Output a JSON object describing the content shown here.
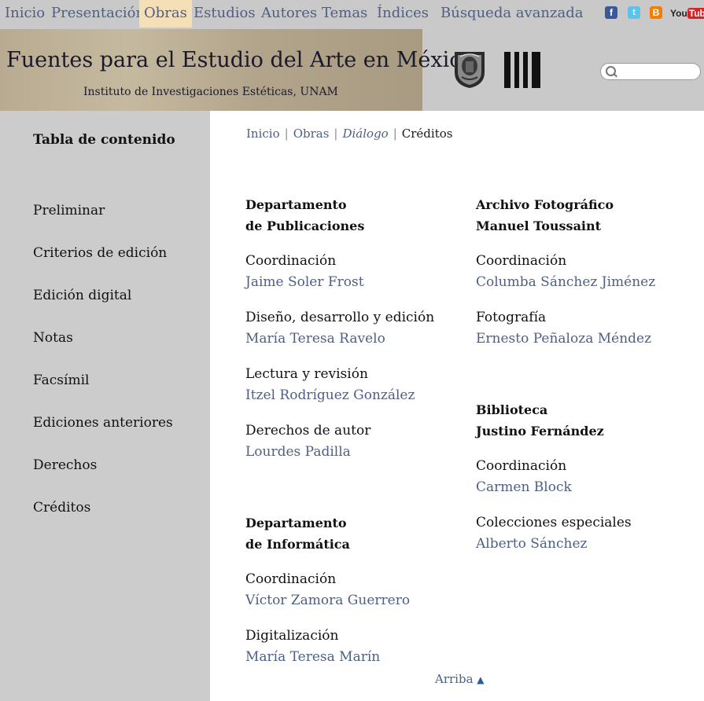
{
  "topnav": {
    "items": [
      {
        "label": "Inicio",
        "active": false
      },
      {
        "label": "Presentación",
        "active": false
      },
      {
        "label": "Obras",
        "active": true
      },
      {
        "label": "Estudios",
        "active": false
      },
      {
        "label": "Autores",
        "active": false
      },
      {
        "label": "Temas",
        "active": false
      },
      {
        "label": "Índices",
        "active": false
      },
      {
        "label": "Búsqueda avanzada",
        "active": false
      }
    ],
    "social": [
      {
        "icon": "facebook-icon",
        "glyph": "f"
      },
      {
        "icon": "twitter-icon",
        "glyph": "t"
      },
      {
        "icon": "blogger-icon",
        "glyph": "B"
      },
      {
        "icon": "youtube-icon",
        "you": "You",
        "tube": "Tube"
      }
    ]
  },
  "banner": {
    "title": "Fuentes para el Estudio del Arte en México",
    "subtitle": "Instituto de Investigaciones Estéticas, UNAM",
    "search_placeholder": ""
  },
  "sidebar": {
    "title": "Tabla de contenido",
    "items": [
      "Preliminar",
      "Criterios de edición",
      "Edición digital",
      "Notas",
      "Facsímil",
      "Ediciones anteriores",
      "Derechos",
      "Créditos"
    ]
  },
  "breadcrumb": {
    "items": [
      "Inicio",
      "Obras",
      "Diálogo"
    ],
    "current": "Créditos"
  },
  "credits": {
    "publicaciones": {
      "title1": "Departamento",
      "title2": "de Publicaciones",
      "entries": [
        {
          "role": "Coordinación",
          "person": "Jaime Soler Frost"
        },
        {
          "role": "Diseño, desarrollo y edición",
          "person": "María Teresa Ravelo"
        },
        {
          "role": "Lectura y revisión",
          "person": "Itzel Rodríguez González"
        },
        {
          "role": "Derechos de autor",
          "person": "Lourdes Padilla"
        }
      ]
    },
    "informatica": {
      "title1": "Departamento",
      "title2": "de Informática",
      "entries": [
        {
          "role": "Coordinación",
          "person": "Víctor Zamora Guerrero"
        },
        {
          "role": "Digitalización",
          "person": "María Teresa Marín"
        }
      ]
    },
    "archivo": {
      "title1": "Archivo Fotográfico",
      "title2": "Manuel Toussaint",
      "entries": [
        {
          "role": "Coordinación",
          "person": "Columba Sánchez Jiménez"
        },
        {
          "role": "Fotografía",
          "person": "Ernesto Peñaloza Méndez"
        }
      ]
    },
    "biblioteca": {
      "title1": "Biblioteca",
      "title2": "Justino Fernández",
      "entries": [
        {
          "role": "Coordinación",
          "person": "Carmen Block"
        },
        {
          "role": "Colecciones especiales",
          "person": "Alberto Sánchez"
        }
      ]
    }
  },
  "footer": {
    "arriba": "Arriba",
    "arrow": "▲"
  },
  "colors": {
    "link": "#4d5f86",
    "nav_bg": "#c9c9c9",
    "active_tab": "#f5dfb6",
    "sidebar_bg": "#cccccc"
  }
}
